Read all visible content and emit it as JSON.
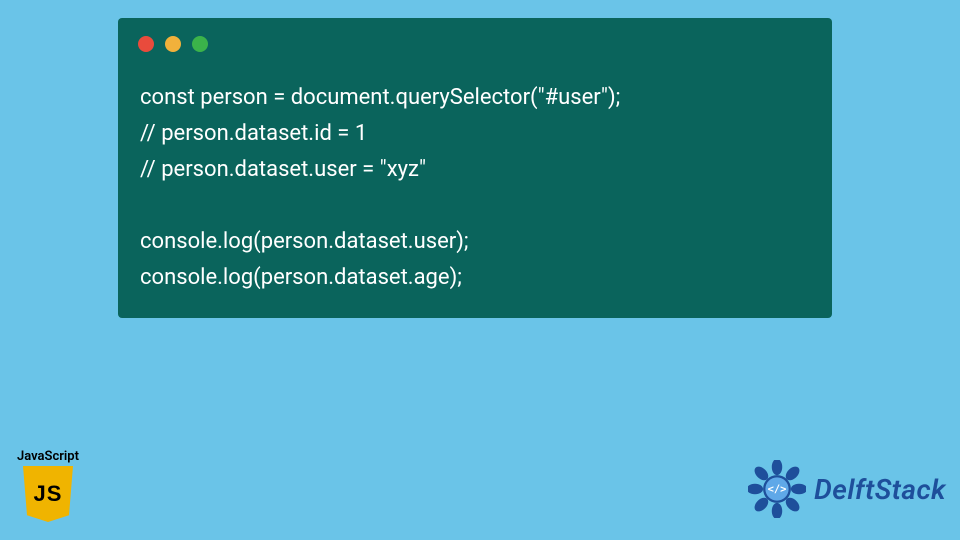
{
  "code": {
    "lines": [
      "const person = document.querySelector(\"#user\");",
      "// person.dataset.id = 1",
      "// person.dataset.user = \"xyz\"",
      "",
      "console.log(person.dataset.user);",
      "console.log(person.dataset.age);"
    ]
  },
  "js_badge": {
    "label": "JavaScript",
    "shield_text": "JS"
  },
  "delft": {
    "text": "DelftStack"
  },
  "colors": {
    "page_bg": "#6ac4e8",
    "card_bg": "#0a645c",
    "code_fg": "#ffffff",
    "js_shield": "#f0b400",
    "delft_text": "#1e4f9b"
  }
}
